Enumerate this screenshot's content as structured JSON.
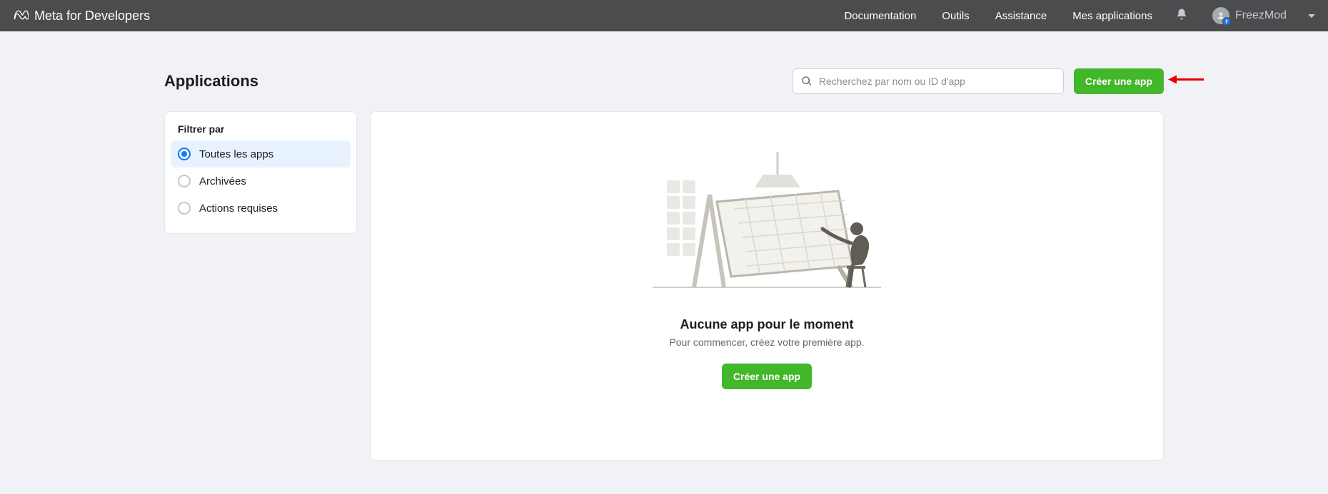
{
  "navbar": {
    "brand": "Meta for Developers",
    "links": {
      "documentation": "Documentation",
      "tools": "Outils",
      "assistance": "Assistance",
      "my_apps": "Mes applications"
    },
    "user_name": "FreezMod"
  },
  "page": {
    "title": "Applications"
  },
  "search": {
    "placeholder": "Recherchez par nom ou ID d'app"
  },
  "buttons": {
    "create_app_header": "Créer une app",
    "create_app_empty": "Créer une app"
  },
  "filter": {
    "title": "Filtrer par",
    "items": [
      {
        "label": "Toutes les apps",
        "selected": true
      },
      {
        "label": "Archivées",
        "selected": false
      },
      {
        "label": "Actions requises",
        "selected": false
      }
    ]
  },
  "empty_state": {
    "title": "Aucune app pour le moment",
    "subtitle": "Pour commencer, créez votre première app."
  }
}
